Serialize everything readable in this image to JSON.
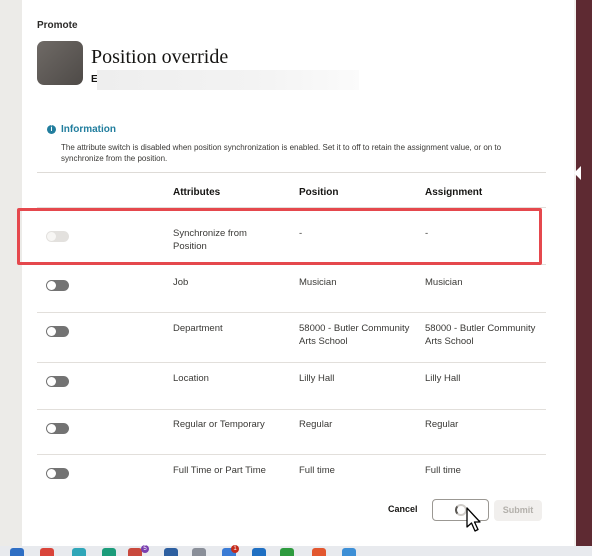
{
  "page": {
    "eyebrow": "Promote",
    "title": "Position override",
    "subtitle": "E"
  },
  "info": {
    "title": "Information",
    "icon": "info-icon",
    "icon_glyph": "i",
    "text": "The attribute switch is disabled when position synchronization is enabled. Set it to off to retain the assignment value, or on to synchronize from the position."
  },
  "table": {
    "headers": {
      "attributes": "Attributes",
      "position": "Position",
      "assignment": "Assignment"
    },
    "rows": [
      {
        "attribute": "Synchronize from Position",
        "position": "-",
        "assignment": "-",
        "switch_on": false,
        "switch_disabled": true
      },
      {
        "attribute": "Job",
        "position": "Musician",
        "assignment": "Musician",
        "switch_on": false,
        "switch_disabled": false
      },
      {
        "attribute": "Department",
        "position": "58000 - Butler Community Arts School",
        "assignment": "58000 - Butler Community Arts School",
        "switch_on": false,
        "switch_disabled": false
      },
      {
        "attribute": "Location",
        "position": "Lilly Hall",
        "assignment": "Lilly Hall",
        "switch_on": false,
        "switch_disabled": false
      },
      {
        "attribute": "Regular or Temporary",
        "position": "Regular",
        "assignment": "Regular",
        "switch_on": false,
        "switch_disabled": false
      },
      {
        "attribute": "Full Time or Part Time",
        "position": "Full time",
        "assignment": "Full time",
        "switch_on": false,
        "switch_disabled": false
      }
    ]
  },
  "actions": {
    "cancel": "Cancel",
    "submit": "Submit"
  },
  "taskbar": {
    "badges": [
      "5",
      "1"
    ]
  },
  "colors": {
    "accent": "#227e9e",
    "highlight": "#e5484d",
    "brand_strip": "#5e2a32"
  }
}
